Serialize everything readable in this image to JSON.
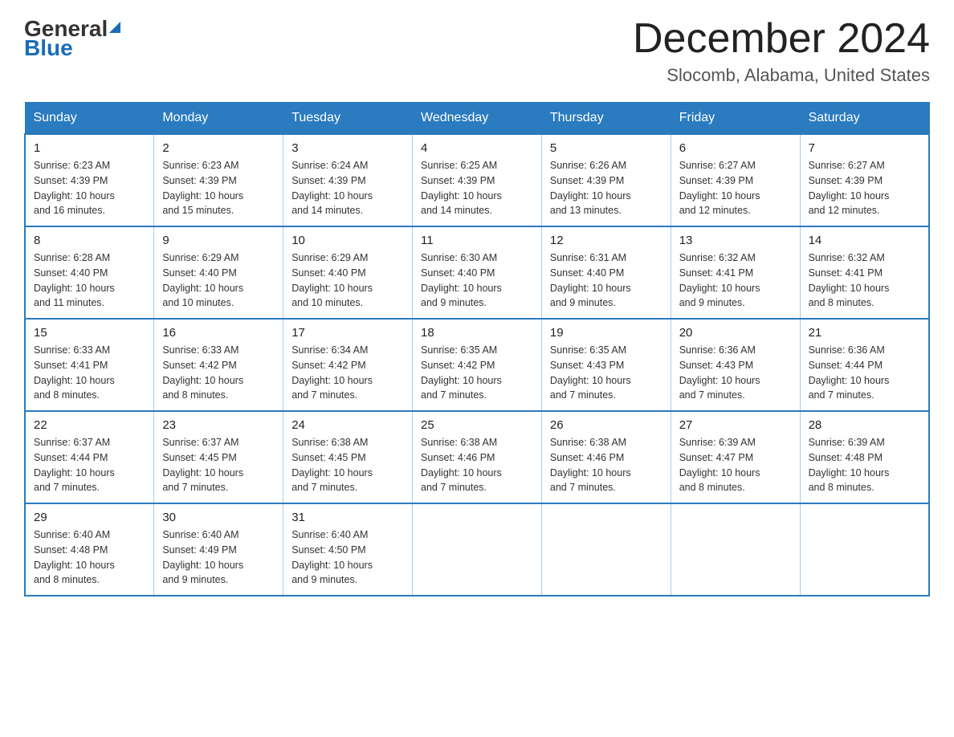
{
  "header": {
    "logo_general": "General",
    "logo_blue": "Blue",
    "month_title": "December 2024",
    "location": "Slocomb, Alabama, United States"
  },
  "days_of_week": [
    "Sunday",
    "Monday",
    "Tuesday",
    "Wednesday",
    "Thursday",
    "Friday",
    "Saturday"
  ],
  "weeks": [
    [
      {
        "day": "1",
        "sunrise": "6:23 AM",
        "sunset": "4:39 PM",
        "daylight": "10 hours and 16 minutes."
      },
      {
        "day": "2",
        "sunrise": "6:23 AM",
        "sunset": "4:39 PM",
        "daylight": "10 hours and 15 minutes."
      },
      {
        "day": "3",
        "sunrise": "6:24 AM",
        "sunset": "4:39 PM",
        "daylight": "10 hours and 14 minutes."
      },
      {
        "day": "4",
        "sunrise": "6:25 AM",
        "sunset": "4:39 PM",
        "daylight": "10 hours and 14 minutes."
      },
      {
        "day": "5",
        "sunrise": "6:26 AM",
        "sunset": "4:39 PM",
        "daylight": "10 hours and 13 minutes."
      },
      {
        "day": "6",
        "sunrise": "6:27 AM",
        "sunset": "4:39 PM",
        "daylight": "10 hours and 12 minutes."
      },
      {
        "day": "7",
        "sunrise": "6:27 AM",
        "sunset": "4:39 PM",
        "daylight": "10 hours and 12 minutes."
      }
    ],
    [
      {
        "day": "8",
        "sunrise": "6:28 AM",
        "sunset": "4:40 PM",
        "daylight": "10 hours and 11 minutes."
      },
      {
        "day": "9",
        "sunrise": "6:29 AM",
        "sunset": "4:40 PM",
        "daylight": "10 hours and 10 minutes."
      },
      {
        "day": "10",
        "sunrise": "6:29 AM",
        "sunset": "4:40 PM",
        "daylight": "10 hours and 10 minutes."
      },
      {
        "day": "11",
        "sunrise": "6:30 AM",
        "sunset": "4:40 PM",
        "daylight": "10 hours and 9 minutes."
      },
      {
        "day": "12",
        "sunrise": "6:31 AM",
        "sunset": "4:40 PM",
        "daylight": "10 hours and 9 minutes."
      },
      {
        "day": "13",
        "sunrise": "6:32 AM",
        "sunset": "4:41 PM",
        "daylight": "10 hours and 9 minutes."
      },
      {
        "day": "14",
        "sunrise": "6:32 AM",
        "sunset": "4:41 PM",
        "daylight": "10 hours and 8 minutes."
      }
    ],
    [
      {
        "day": "15",
        "sunrise": "6:33 AM",
        "sunset": "4:41 PM",
        "daylight": "10 hours and 8 minutes."
      },
      {
        "day": "16",
        "sunrise": "6:33 AM",
        "sunset": "4:42 PM",
        "daylight": "10 hours and 8 minutes."
      },
      {
        "day": "17",
        "sunrise": "6:34 AM",
        "sunset": "4:42 PM",
        "daylight": "10 hours and 7 minutes."
      },
      {
        "day": "18",
        "sunrise": "6:35 AM",
        "sunset": "4:42 PM",
        "daylight": "10 hours and 7 minutes."
      },
      {
        "day": "19",
        "sunrise": "6:35 AM",
        "sunset": "4:43 PM",
        "daylight": "10 hours and 7 minutes."
      },
      {
        "day": "20",
        "sunrise": "6:36 AM",
        "sunset": "4:43 PM",
        "daylight": "10 hours and 7 minutes."
      },
      {
        "day": "21",
        "sunrise": "6:36 AM",
        "sunset": "4:44 PM",
        "daylight": "10 hours and 7 minutes."
      }
    ],
    [
      {
        "day": "22",
        "sunrise": "6:37 AM",
        "sunset": "4:44 PM",
        "daylight": "10 hours and 7 minutes."
      },
      {
        "day": "23",
        "sunrise": "6:37 AM",
        "sunset": "4:45 PM",
        "daylight": "10 hours and 7 minutes."
      },
      {
        "day": "24",
        "sunrise": "6:38 AM",
        "sunset": "4:45 PM",
        "daylight": "10 hours and 7 minutes."
      },
      {
        "day": "25",
        "sunrise": "6:38 AM",
        "sunset": "4:46 PM",
        "daylight": "10 hours and 7 minutes."
      },
      {
        "day": "26",
        "sunrise": "6:38 AM",
        "sunset": "4:46 PM",
        "daylight": "10 hours and 7 minutes."
      },
      {
        "day": "27",
        "sunrise": "6:39 AM",
        "sunset": "4:47 PM",
        "daylight": "10 hours and 8 minutes."
      },
      {
        "day": "28",
        "sunrise": "6:39 AM",
        "sunset": "4:48 PM",
        "daylight": "10 hours and 8 minutes."
      }
    ],
    [
      {
        "day": "29",
        "sunrise": "6:40 AM",
        "sunset": "4:48 PM",
        "daylight": "10 hours and 8 minutes."
      },
      {
        "day": "30",
        "sunrise": "6:40 AM",
        "sunset": "4:49 PM",
        "daylight": "10 hours and 9 minutes."
      },
      {
        "day": "31",
        "sunrise": "6:40 AM",
        "sunset": "4:50 PM",
        "daylight": "10 hours and 9 minutes."
      },
      null,
      null,
      null,
      null
    ]
  ],
  "labels": {
    "sunrise": "Sunrise:",
    "sunset": "Sunset:",
    "daylight": "Daylight:"
  }
}
